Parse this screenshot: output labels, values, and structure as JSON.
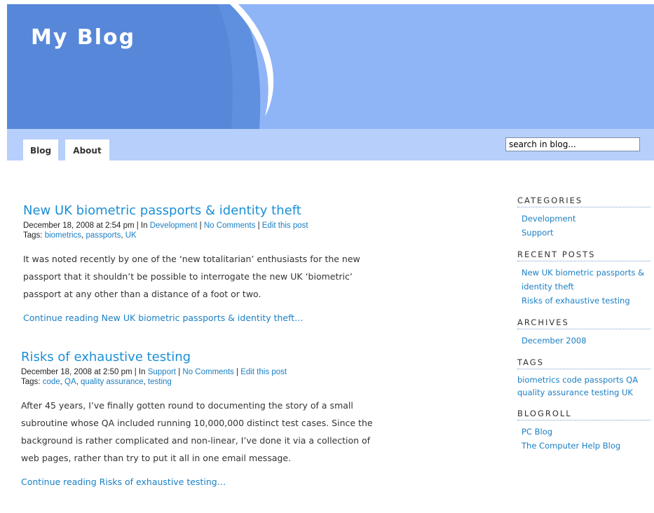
{
  "header": {
    "site_title": "My Blog",
    "search_placeholder": "search in blog..."
  },
  "nav": {
    "tabs": [
      {
        "label": "Blog"
      },
      {
        "label": "About"
      }
    ]
  },
  "posts": [
    {
      "title": "New UK biometric passports & identity theft",
      "date": "December 18, 2008 at 2:54 pm",
      "in_label": " | In ",
      "category": "Development",
      "comments": "No Comments",
      "edit": "Edit this post",
      "tags_label": "Tags: ",
      "tags": [
        "biometrics",
        "passports",
        "UK"
      ],
      "excerpt": "It was noted recently by one of the ‘new totalitarian’ enthusiasts for the new passport that it shouldn’t be possible to interrogate the new UK ‘biometric’ passport at any other than a distance of a foot or two.",
      "continue": "Continue reading New UK biometric passports & identity theft…"
    },
    {
      "title": "Risks of exhaustive testing",
      "date": "December 18, 2008 at 2:50 pm",
      "in_label": " | In ",
      "category": "Support",
      "comments": "No Comments",
      "edit": "Edit this post",
      "tags_label": "Tags: ",
      "tags": [
        "code",
        "QA",
        "quality assurance",
        "testing"
      ],
      "excerpt": "After 45 years, I’ve finally gotten round to documenting the story of a small subroutine whose QA included running 10,000,000 distinct test cases.  Since the background is rather complicated and non-linear, I’ve done it via a collection of web pages, rather than try to put it all in one email message.",
      "continue": "Continue reading Risks of exhaustive testing…"
    }
  ],
  "sidebar": {
    "categories": {
      "heading": "CATEGORIES",
      "items": [
        "Development",
        "Support"
      ]
    },
    "recent_posts": {
      "heading": "RECENT POSTS",
      "items": [
        "New UK biometric passports & identity theft",
        "Risks of exhaustive testing"
      ]
    },
    "archives": {
      "heading": "ARCHIVES",
      "items": [
        "December 2008"
      ]
    },
    "tags": {
      "heading": "TAGS",
      "items": [
        "biometrics",
        "code",
        "passports",
        "QA",
        "quality assurance",
        "testing",
        "UK"
      ]
    },
    "blogroll": {
      "heading": "BLOGROLL",
      "items": [
        "PC Blog",
        "The Computer Help Blog"
      ]
    }
  }
}
